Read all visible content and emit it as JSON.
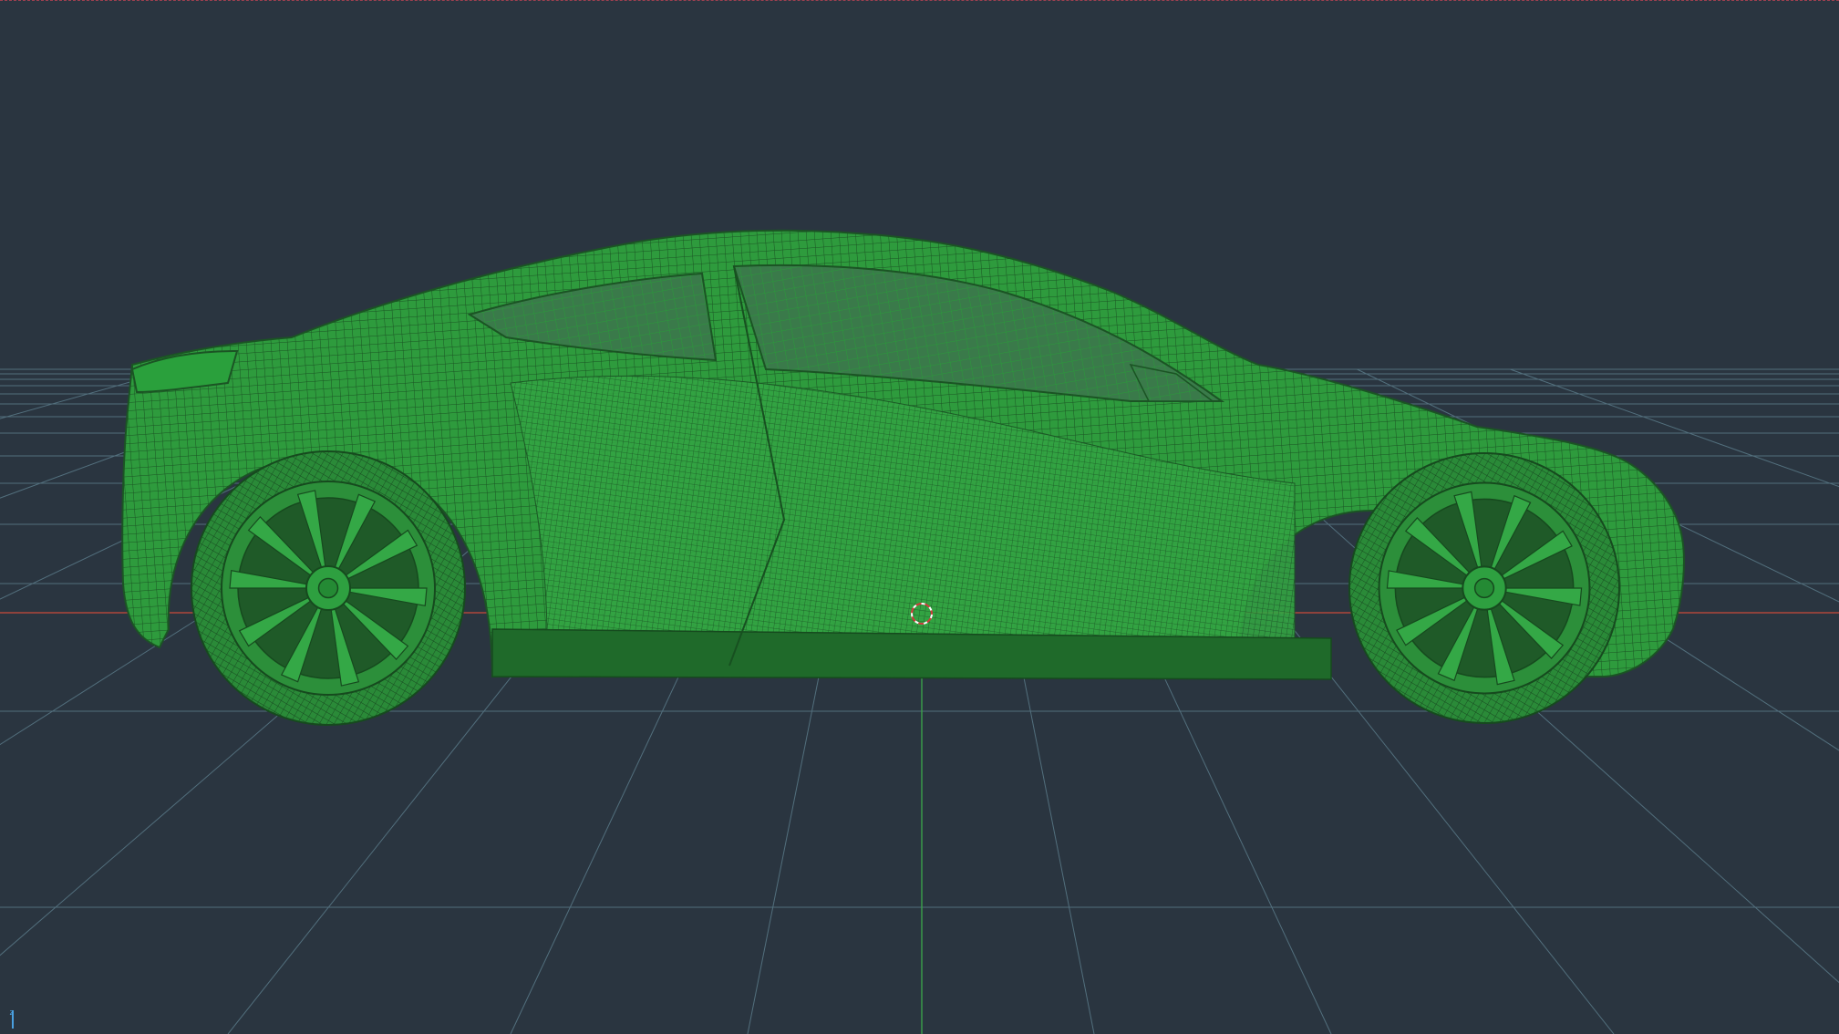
{
  "viewport": {
    "background_color": "#2a3540",
    "grid_color": "#5a7a88",
    "x_axis_color": "#b0463a",
    "y_axis_color": "#3aa04a",
    "model_color": "#2e9e3e",
    "model_wire_color": "#1e5a26",
    "axis_label": "z",
    "model_name": "sports-car-wireframe"
  }
}
